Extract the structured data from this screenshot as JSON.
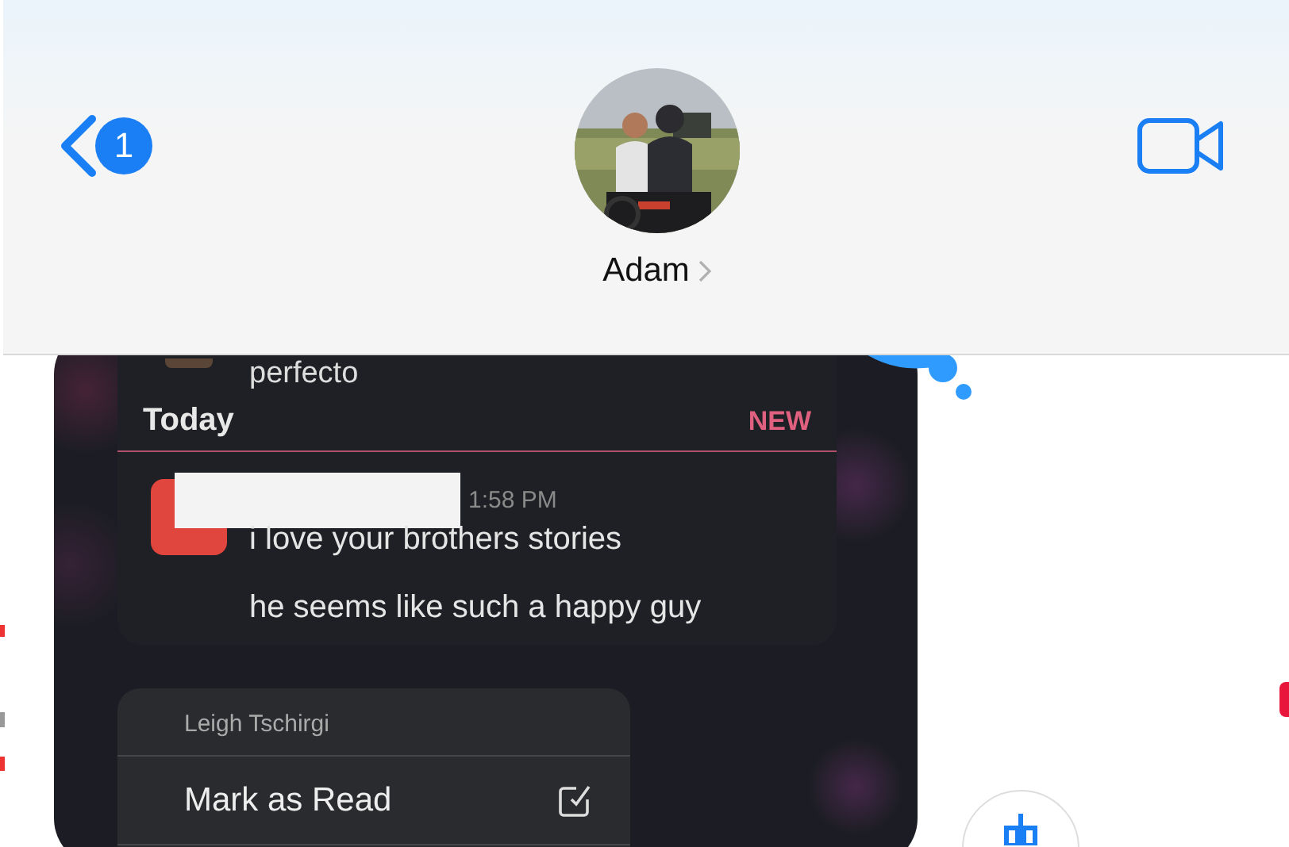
{
  "header": {
    "back_badge": "1",
    "contact_name": "Adam"
  },
  "preview": {
    "previous_message": "perfecto",
    "section_title": "Today",
    "new_label": "NEW",
    "time": "1:58 PM",
    "messages": [
      "i love your brothers stories",
      "he seems like such a happy guy"
    ]
  },
  "context_menu": {
    "title": "Leigh Tschirgi",
    "items": [
      {
        "label": "Mark as Read",
        "kind": "mark-read"
      }
    ]
  }
}
